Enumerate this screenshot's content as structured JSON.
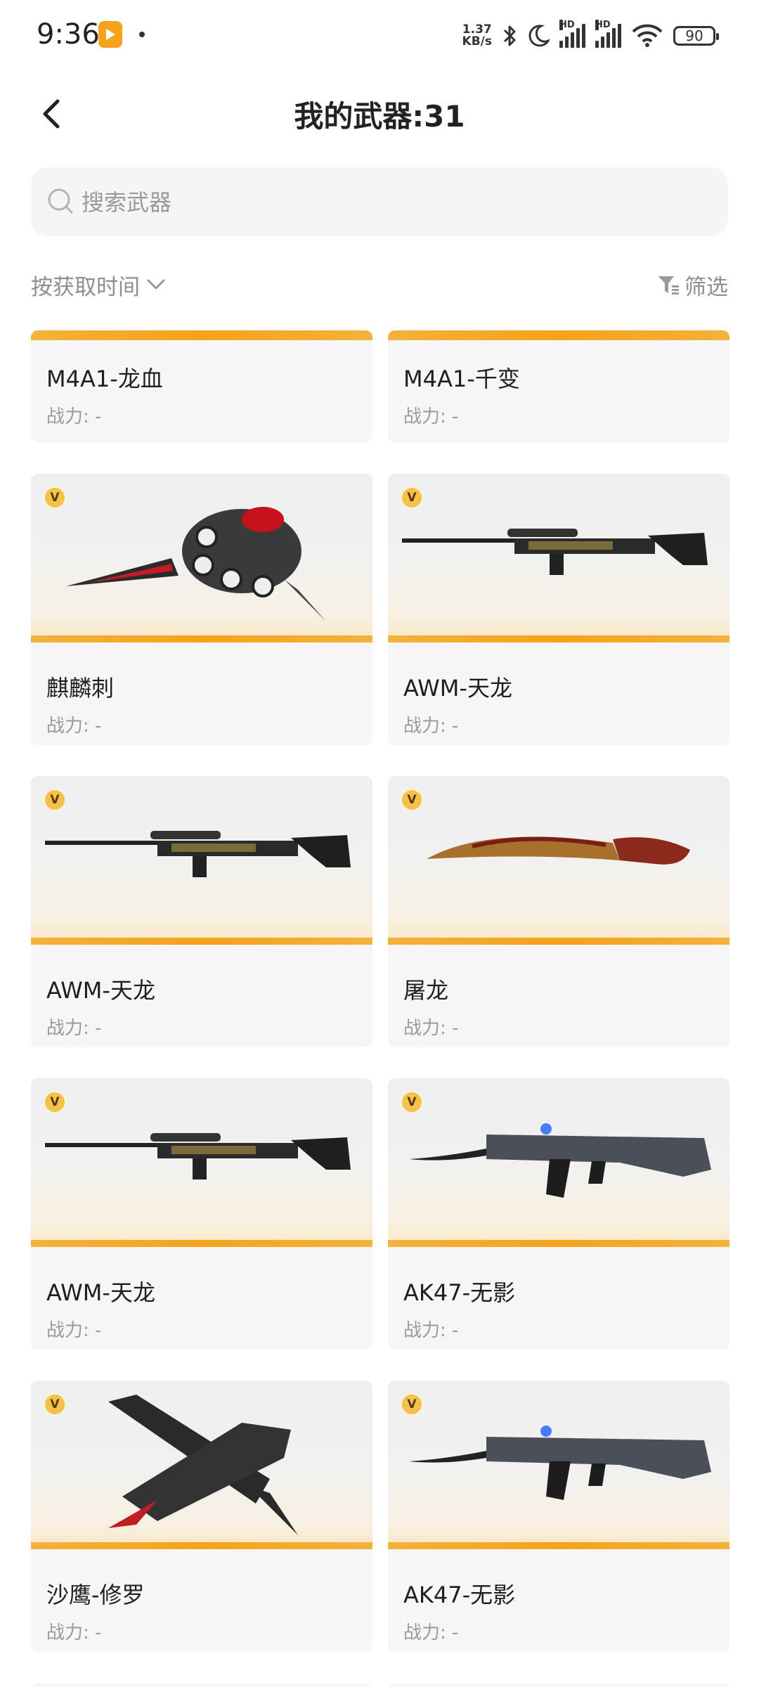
{
  "status_bar": {
    "time": "9:36",
    "net_speed_value": "1.37",
    "net_speed_unit": "KB/s",
    "sim1_label": "HD",
    "sim2_label": "HD",
    "battery": "90"
  },
  "header": {
    "title": "我的武器:31"
  },
  "search": {
    "placeholder": "搜索武器",
    "value": ""
  },
  "toolbar": {
    "sort_label": "按获取时间",
    "filter_label": "筛选"
  },
  "weapons": [
    {
      "name": "M4A1-龙血",
      "power": "战力: -",
      "icon": "rifle-image"
    },
    {
      "name": "M4A1-千变",
      "power": "战力: -",
      "icon": "rifle-image"
    },
    {
      "name": "麒麟刺",
      "power": "战力: -",
      "icon": "knuckle-blade-image",
      "badge": "V"
    },
    {
      "name": "AWM-天龙",
      "power": "战力: -",
      "icon": "sniper-rifle-image",
      "badge": "V"
    },
    {
      "name": "AWM-天龙",
      "power": "战力: -",
      "icon": "sniper-rifle-image",
      "badge": "V"
    },
    {
      "name": "屠龙",
      "power": "战力: -",
      "icon": "kukri-knife-image",
      "badge": "V"
    },
    {
      "name": "AWM-天龙",
      "power": "战力: -",
      "icon": "sniper-rifle-image",
      "badge": "V"
    },
    {
      "name": "AK47-无影",
      "power": "战力: -",
      "icon": "assault-rifle-image",
      "badge": "V"
    },
    {
      "name": "沙鹰-修罗",
      "power": "战力: -",
      "icon": "pistol-blade-image",
      "badge": "V"
    },
    {
      "name": "AK47-无影",
      "power": "战力: -",
      "icon": "assault-rifle-image",
      "badge": "V"
    }
  ],
  "colors": {
    "accent": "#f6a21b",
    "badge": "#f2c14e",
    "muted_text": "#9a9a9a"
  }
}
